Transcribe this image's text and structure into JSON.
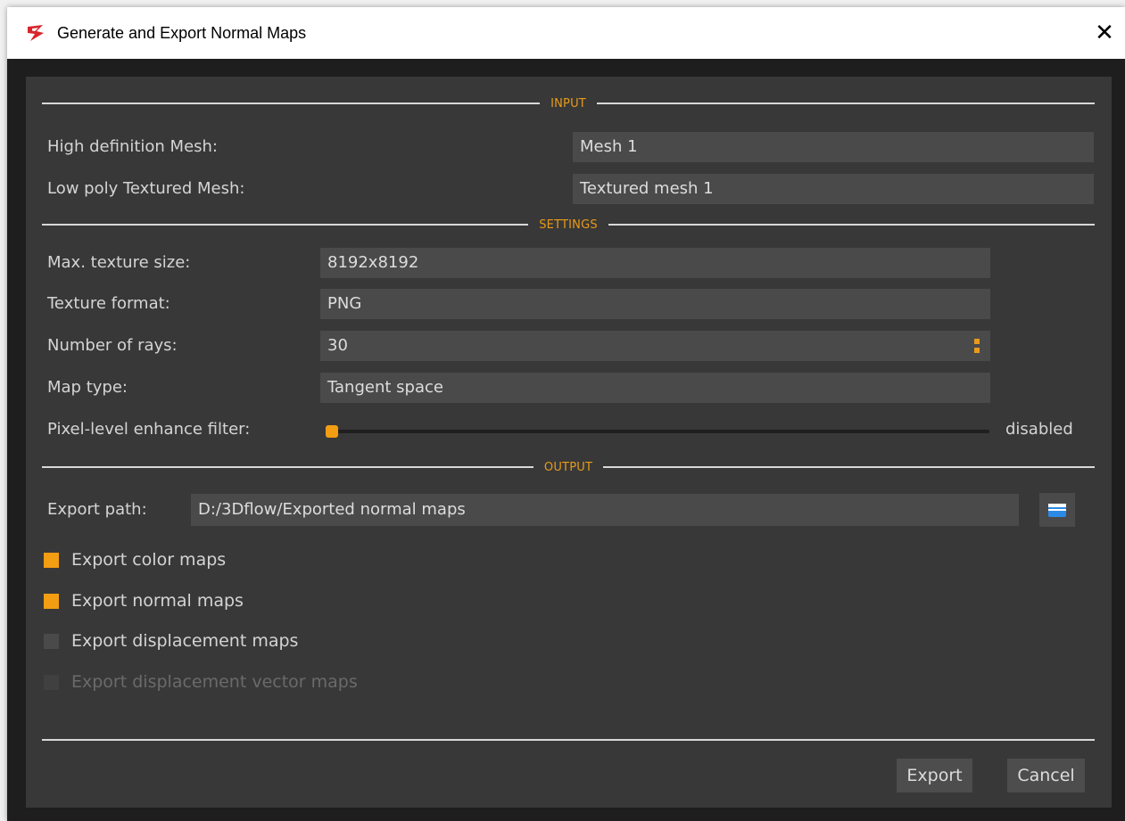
{
  "window": {
    "title": "Generate and Export Normal Maps",
    "close_glyph": "✕",
    "app_icon": "3dflow-logo-icon",
    "accent_color": "#f29d12"
  },
  "sections": {
    "input": "INPUT",
    "settings": "SETTINGS",
    "output": "OUTPUT"
  },
  "input": {
    "high_def_label": "High definition Mesh:",
    "high_def_value": "Mesh 1",
    "low_poly_label": "Low poly Textured Mesh:",
    "low_poly_value": "Textured mesh 1"
  },
  "settings": {
    "max_texture_label": "Max. texture size:",
    "max_texture_value": "8192x8192",
    "format_label": "Texture format:",
    "format_value": "PNG",
    "rays_label": "Number of rays:",
    "rays_value": "30",
    "map_type_label": "Map type:",
    "map_type_value": "Tangent space",
    "enhance_label": "Pixel-level enhance filter:",
    "enhance_value_text": "disabled",
    "enhance_level": 0
  },
  "output": {
    "export_path_label": "Export path:",
    "export_path_value": "D:/3Dflow/Exported normal maps",
    "folder_icon": "folder-icon",
    "checkboxes": [
      {
        "label": "Export color maps",
        "checked": true,
        "enabled": true
      },
      {
        "label": "Export normal maps",
        "checked": true,
        "enabled": true
      },
      {
        "label": "Export displacement maps",
        "checked": false,
        "enabled": true
      },
      {
        "label": "Export displacement vector maps",
        "checked": false,
        "enabled": false
      }
    ]
  },
  "buttons": {
    "export": "Export",
    "cancel": "Cancel"
  }
}
